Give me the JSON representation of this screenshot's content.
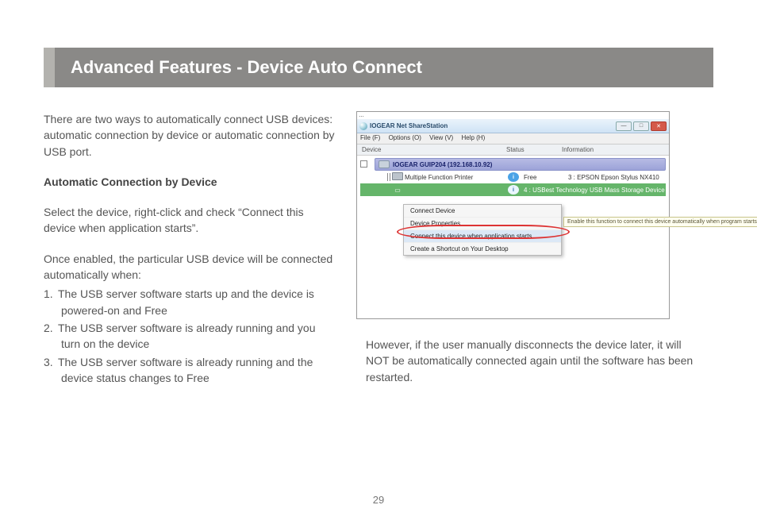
{
  "title": "Advanced Features - Device Auto Connect",
  "intro": "There are two ways to automatically connect USB devices: automatic connection by device or automatic connection by USB port.",
  "subheading": "Automatic Connection by Device",
  "instruction": "Select the device, right-click and check “Connect this device when application starts”.",
  "once_enabled": "Once enabled, the particular USB device will be connected automatically when:",
  "conditions": [
    "The USB server software starts up and the device is powered-on and Free",
    "The USB server software is already running and you turn on the device",
    "The USB server software is already running and the device status changes to Free"
  ],
  "note": "However, if the user manually disconnects the device later, it will NOT be automatically connected again until the software has been restarted.",
  "page_number": "29",
  "screenshot": {
    "app_title": "IOGEAR Net ShareStation",
    "menubar": {
      "file": "File (F)",
      "options": "Options (O)",
      "view": "View (V)",
      "help": "Help (H)"
    },
    "columns": {
      "device": "Device",
      "status": "Status",
      "info": "Information"
    },
    "group": "IOGEAR GUIP204  (192.168.10.92)",
    "row1": {
      "name": "Multiple Function Printer",
      "status": "Free",
      "info": "3 : EPSON Epson Stylus NX410"
    },
    "row2": {
      "info": "4 : USBest Technology USB Mass Storage Device"
    },
    "context_menu": {
      "connect": "Connect Device",
      "properties": "Device Properties",
      "auto": "Connect this device when application starts",
      "shortcut": "Create a Shortcut on Your Desktop"
    },
    "tooltip": "Enable this function to connect this device automatically when program starts."
  }
}
